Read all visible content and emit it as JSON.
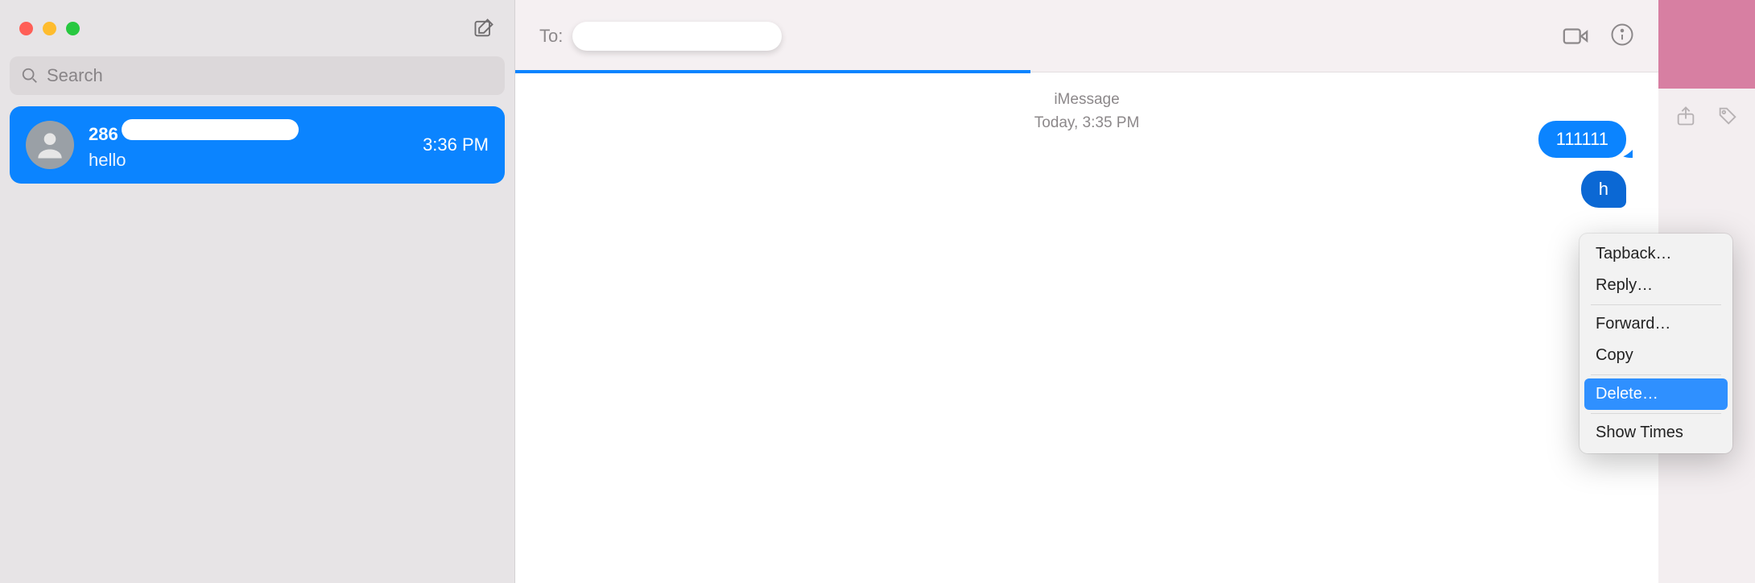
{
  "sidebar": {
    "search_placeholder": "Search",
    "conversation": {
      "name_prefix": "286",
      "time": "3:36 PM",
      "preview": "hello"
    }
  },
  "chat": {
    "to_label": "To:",
    "service_line": "iMessage",
    "time_line": "Today, 3:35 PM",
    "bubble1": "111111",
    "bubble2_partial": "h"
  },
  "context_menu": {
    "tapback": "Tapback…",
    "reply": "Reply…",
    "forward": "Forward…",
    "copy": "Copy",
    "delete": "Delete…",
    "show_times": "Show Times"
  }
}
